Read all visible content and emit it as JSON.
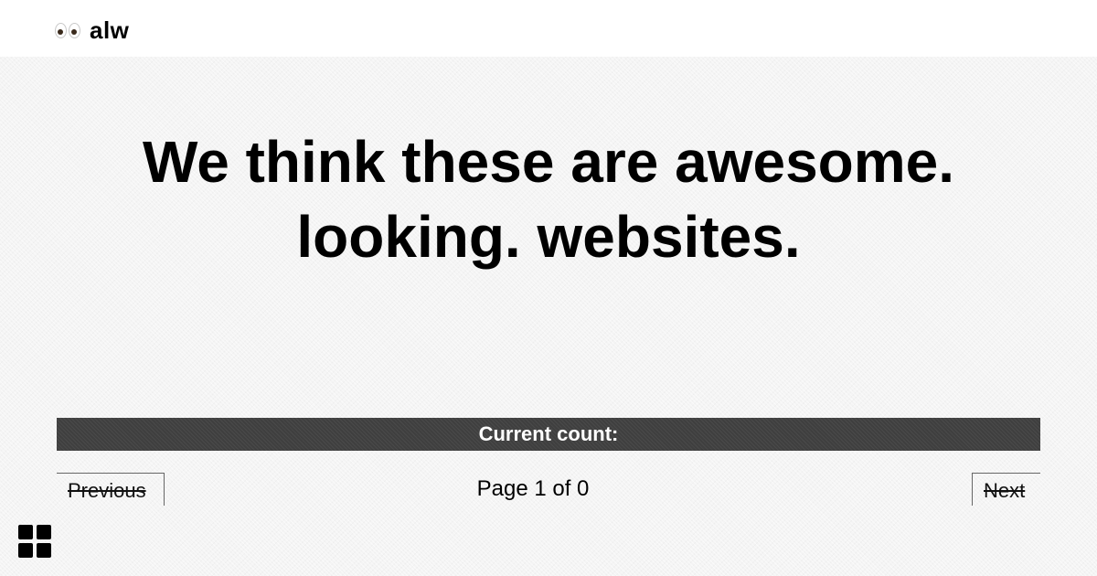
{
  "header": {
    "brand_icon": "eyes-emoji",
    "brand_name": "alw"
  },
  "hero": {
    "line1": "We think these are awesome.",
    "line2": "looking. websites."
  },
  "counter": {
    "label": "Current count:"
  },
  "pagination": {
    "previous_label": "Previous",
    "next_label": "Next",
    "page_text": "Page 1 of 0"
  },
  "footer": {
    "menu_icon": "grid-icon"
  },
  "colors": {
    "count_bar_bg": "#3f3f3f",
    "page_bg": "#f4f4f4",
    "header_bg": "#ffffff"
  }
}
